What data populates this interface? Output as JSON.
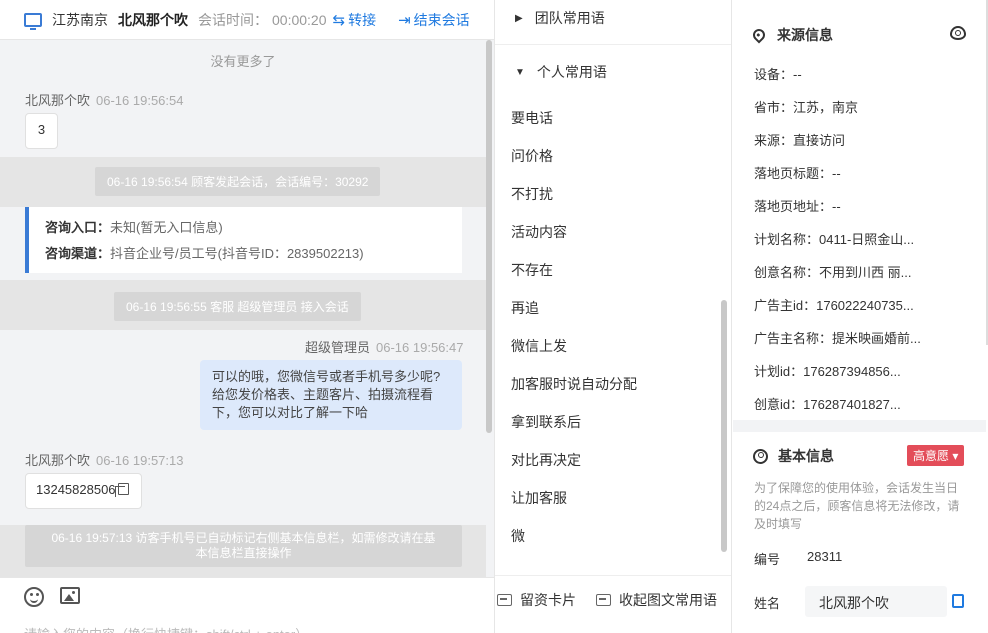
{
  "header": {
    "location": "江苏南京",
    "visitor_name": "北风那个吹",
    "time_label": "会话时间：",
    "time_value": "00:00:20",
    "transfer": "转接",
    "end": "结束会话",
    "colors": {
      "accent": "#1f7ae0"
    }
  },
  "chat": {
    "no_more": "没有更多了",
    "m1_sender": "北风那个吹",
    "m1_time": "06-16 19:56:54",
    "m1_text": "3",
    "sys1": "06-16 19:56:54 顾客发起会话，会话编号：30292",
    "consult_entry_label": "咨询入口：",
    "consult_entry_value": "未知(暂无入口信息)",
    "consult_channel_label": "咨询渠道：",
    "consult_channel_value": "抖音企业号/员工号(抖音号ID：2839502213)",
    "sys2": "06-16 19:56:55 客服 超级管理员 接入会话",
    "m2_sender": "超级管理员",
    "m2_time": "06-16 19:56:47",
    "m2_lines": [
      "可以的哦，您微信号或者手机号多少呢?",
      "给您发价格表、主题客片、拍摄流程看",
      "下，您可以对比了解一下哈"
    ],
    "m3_sender": "北风那个吹",
    "m3_time": "06-16 19:57:13",
    "m3_text": "13245828506",
    "sys3_l1": "06-16 19:57:13 访客手机号已自动标记右侧基本信息栏，如需修改请在基",
    "sys3_l2": "本信息栏直接操作",
    "input_placeholder": "请输入您的内容（换行快捷键：shift/ctrl + enter）"
  },
  "phrases": {
    "team_group": "团队常用语",
    "personal_group": "个人常用语",
    "items": [
      "要电话",
      "问价格",
      "不打扰",
      "活动内容",
      "不存在",
      "再追",
      "微信上发",
      "加客服时说自动分配",
      "拿到联系后",
      "对比再决定",
      "让加客服",
      "微"
    ],
    "leave_card": "留资卡片",
    "collapse": "收起图文常用语"
  },
  "source": {
    "title": "来源信息",
    "rows": [
      "设备：--",
      "省市：江苏，南京",
      "来源：直接访问",
      "落地页标题：--",
      "落地页地址：--",
      "计划名称：0411-日照金山...",
      "创意名称：不用到川西 丽...",
      "广告主id：176022240735...",
      "广告主名称：提米映画婚前...",
      "计划id：176287394856...",
      "创意id：176287401827..."
    ]
  },
  "basic": {
    "title": "基本信息",
    "intent": "高意愿",
    "intent_color": "#e34d59",
    "note": "为了保障您的使用体验，会话发生当日的24点之后，顾客信息将无法修改，请及时填写",
    "id_label": "编号",
    "id_value": "28311",
    "name_label": "姓名",
    "name_value": "北风那个吹"
  }
}
